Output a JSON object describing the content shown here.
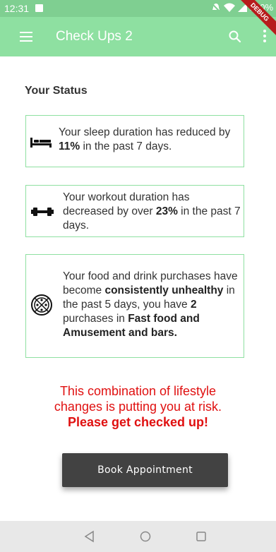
{
  "status_bar": {
    "time": "12:31",
    "battery": "100%",
    "ribbon": "DEBUG"
  },
  "app_bar": {
    "title": "Check Ups 2",
    "icons": [
      "menu-icon",
      "search-icon",
      "more-vert-icon"
    ],
    "color": "#8ee0a1"
  },
  "status": {
    "heading": "Your Status",
    "cards": [
      {
        "icon": "bed-icon",
        "parts": [
          "Your sleep duration has reduced by ",
          "11%",
          " in the past 7 days."
        ]
      },
      {
        "icon": "dumbbell-icon",
        "parts": [
          "Your workout duration has decreased by over ",
          "23%",
          " in the past 7 days."
        ]
      },
      {
        "icon": "pizza-icon",
        "parts": [
          "Your food and drink purchases have become ",
          "consistently unhealthy",
          " in the past 5 days, you have ",
          "2",
          " purchases in ",
          "Fast food and Amusement and bars."
        ]
      }
    ]
  },
  "warning": {
    "line1": "This combination of lifestyle",
    "line2": "changes is putting you at risk.",
    "line3": "Please get checked up!",
    "color": "#e01010"
  },
  "actions": {
    "book_label": "Book Appointment"
  },
  "nav_bar": {
    "icons": [
      "back-icon",
      "home-icon",
      "recents-icon"
    ]
  }
}
